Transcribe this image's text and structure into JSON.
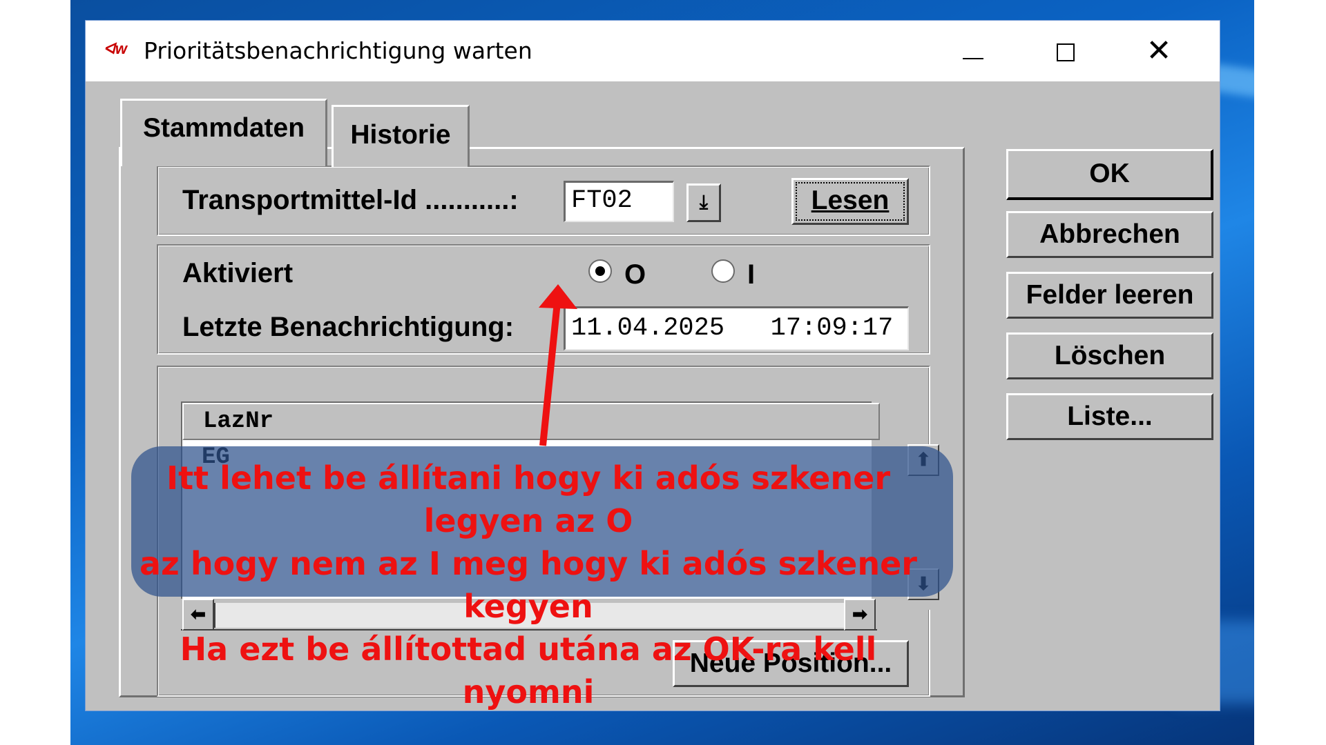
{
  "window": {
    "title": "Prioritätsbenachrichtigung warten",
    "logo": "ᐊw"
  },
  "tabs": [
    {
      "label": "Stammdaten",
      "active": true
    },
    {
      "label": "Historie",
      "active": false
    }
  ],
  "form": {
    "transport_label": "Transportmittel-Id ...........:",
    "transport_value": "FT02",
    "lesen_button": "Lesen",
    "aktiviert_label": "Aktiviert",
    "radio_o_label": "O",
    "radio_i_label": "I",
    "radio_selected": "O",
    "last_notification_label": "Letzte Benachrichtigung:",
    "last_notification_value": "11.04.2025   17:09:17"
  },
  "list": {
    "header": "LazNr",
    "rows": [
      "EG"
    ]
  },
  "neue_position_button": "Neue Position...",
  "side_buttons": [
    "OK",
    "Abbrechen",
    "Felder leeren",
    "Löschen",
    "Liste..."
  ],
  "annotation": {
    "line1": "Itt lehet be állítani hogy ki adós szkener legyen az O",
    "line2": "az hogy nem az I meg hogy ki adós szkener kegyen",
    "line3": "Ha ezt be állítottad utána az OK-ra kell nyomni",
    "color": "#ee1111"
  },
  "icons": [
    "close-icon",
    "minimize-icon",
    "maximize-icon",
    "dropdown-arrow-icon",
    "scroll-up-icon",
    "scroll-down-icon",
    "scroll-left-icon",
    "scroll-right-icon"
  ]
}
